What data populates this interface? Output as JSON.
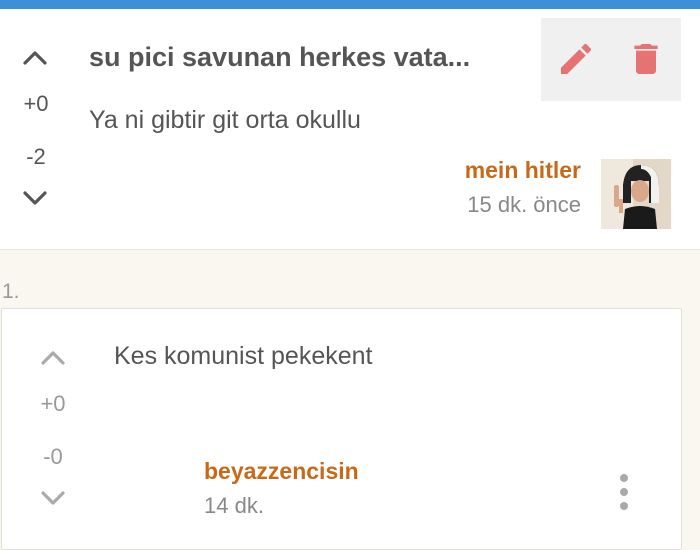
{
  "post": {
    "title": "su pici savunan herkes vata...",
    "body": "Ya ni gibtir git orta okullu",
    "upvotes": "+0",
    "downvotes": "-2",
    "author": "mein hitler",
    "time": "15 dk. önce"
  },
  "reply": {
    "index": "1.",
    "body": "Kes komunist pekekent",
    "upvotes": "+0",
    "downvotes": "-0",
    "author": "beyazzencisin",
    "time": "14 dk."
  },
  "colors": {
    "topbar": "#3d8fd8",
    "username": "#c8691a",
    "action_icon": "#e57373"
  },
  "icons": [
    "chevron-up-icon",
    "chevron-down-icon",
    "pencil-icon",
    "trash-icon",
    "kebab-menu-icon"
  ]
}
